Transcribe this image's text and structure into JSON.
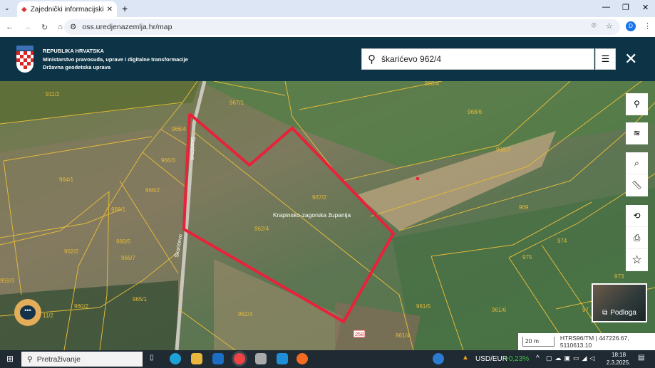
{
  "browser": {
    "tab_title": "Zajednički informacijski sustav",
    "url": "oss.uredjenazemlja.hr/map",
    "profile_initial": "D"
  },
  "header": {
    "org_line1": "REPUBLIKA HRVATSKA",
    "org_line2": "Ministarstvo pravosuđa, uprave i digitalne transformacije",
    "org_line3": "Državna geodetska uprava",
    "search_value": "škarićevo 962/4"
  },
  "map": {
    "county_label": "Krapinsko-zagorska županija",
    "street_label": "Škarićevo",
    "house_number": "258",
    "parcels": [
      "911/2",
      "966/4",
      "967/1",
      "968/4",
      "968/6",
      "968/7",
      "966/3",
      "964/1",
      "966/2",
      "967/2",
      "969",
      "966/1",
      "962/4",
      "966/5",
      "966/7",
      "962/2",
      "974",
      "975",
      "973",
      "959/3",
      "965/1",
      "960/2",
      "11/2",
      "962/3",
      "961/5",
      "961/6",
      "961/4",
      "97"
    ],
    "basemap_label": "Podloga",
    "scale": "20 m",
    "coords": "HTRS96/TM | 447226.67, 5110613.10",
    "parcel_color": "#e2b93a",
    "highlight_color": "#e8223a"
  },
  "taskbar": {
    "search_placeholder": "Pretraživanje",
    "ticker": "USD/EUR",
    "ticker_change": "+0,23%",
    "time": "18:18",
    "date": "2.3.2025."
  }
}
